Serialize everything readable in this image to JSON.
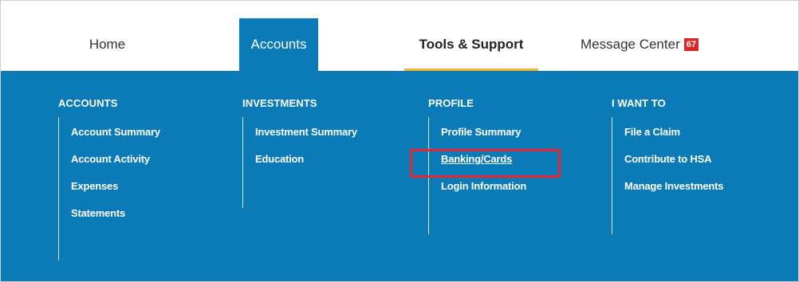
{
  "topnav": {
    "home": "Home",
    "accounts": "Accounts",
    "tools_support": "Tools & Support",
    "message_center": "Message Center",
    "message_count": "67"
  },
  "menu": {
    "columns": [
      {
        "heading": "ACCOUNTS",
        "links": [
          "Account Summary",
          "Account Activity",
          "Expenses",
          "Statements"
        ]
      },
      {
        "heading": "INVESTMENTS",
        "links": [
          "Investment Summary",
          "Education"
        ]
      },
      {
        "heading": "PROFILE",
        "links": [
          "Profile Summary",
          "Banking/Cards",
          "Login Information"
        ]
      },
      {
        "heading": "I WANT TO",
        "links": [
          "File a Claim",
          "Contribute to HSA",
          "Manage Investments"
        ]
      }
    ]
  },
  "colors": {
    "primary_blue": "#0b7bb7",
    "active_underline": "#f1b434",
    "badge_red": "#d9262b",
    "highlight_red": "#e8262b"
  }
}
